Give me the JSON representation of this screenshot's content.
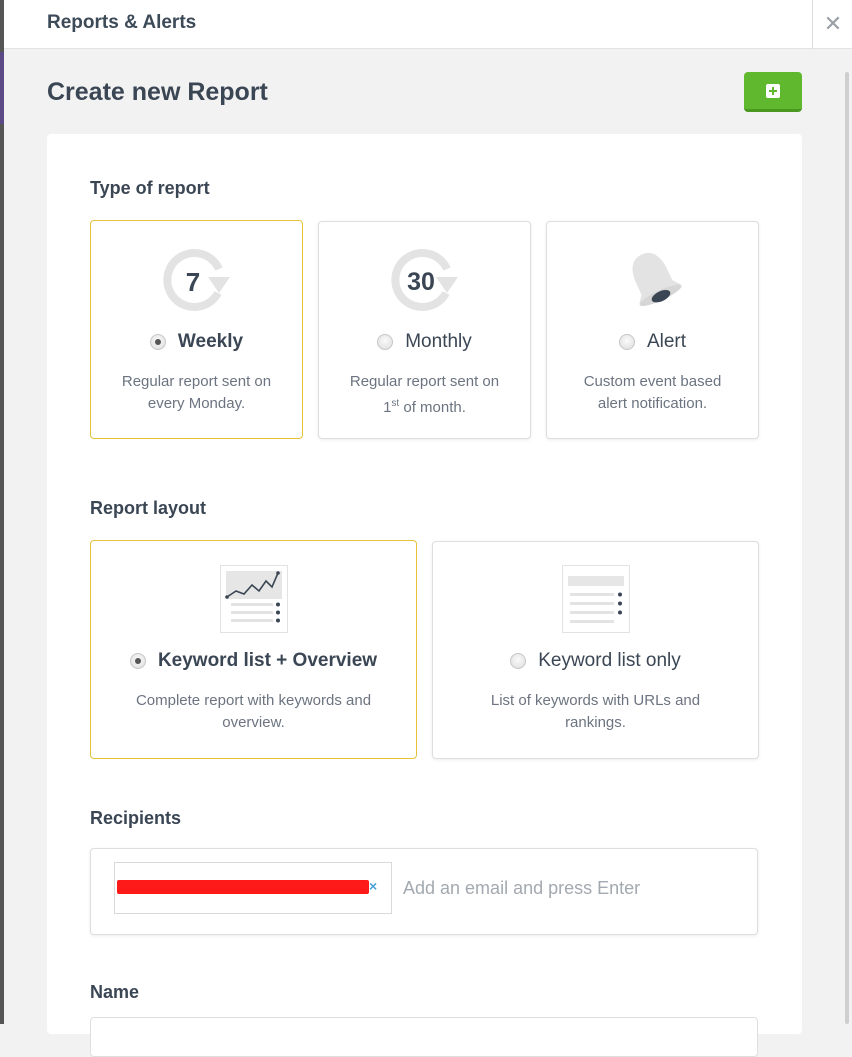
{
  "panel": {
    "title": "Reports & Alerts",
    "close_icon": "close-icon"
  },
  "page": {
    "title": "Create new Report",
    "add_button_icon": "plus-square-icon",
    "add_button_color": "#5fb82e"
  },
  "type_of_report": {
    "label": "Type of report",
    "options": [
      {
        "label": "Weekly",
        "icon_number": "7",
        "description_line1": "Regular report sent on",
        "description_line2": "every Monday.",
        "selected": true
      },
      {
        "label": "Monthly",
        "icon_number": "30",
        "description_line1_pre": "Regular report sent on",
        "description_line2_num": "1",
        "description_line2_sup": "st",
        "description_line2_post": " of month.",
        "selected": false
      },
      {
        "label": "Alert",
        "icon": "bell-icon",
        "description_line1": "Custom event based",
        "description_line2": "alert notification.",
        "selected": false
      }
    ]
  },
  "report_layout": {
    "label": "Report layout",
    "options": [
      {
        "label": "Keyword list + Overview",
        "icon": "chart-list-icon",
        "description_line1": "Complete report with keywords and",
        "description_line2": "overview.",
        "selected": true
      },
      {
        "label": "Keyword list only",
        "icon": "list-icon",
        "description_line1": "List of keywords with URLs and",
        "description_line2": "rankings.",
        "selected": false
      }
    ]
  },
  "recipients": {
    "label": "Recipients",
    "placeholder": "Add an email and press Enter",
    "chip_remove": "×"
  },
  "name": {
    "label": "Name",
    "value": ""
  },
  "colors": {
    "selected_border": "#e6c13c",
    "accent_green": "#5fb82e",
    "text": "#3b4654"
  }
}
